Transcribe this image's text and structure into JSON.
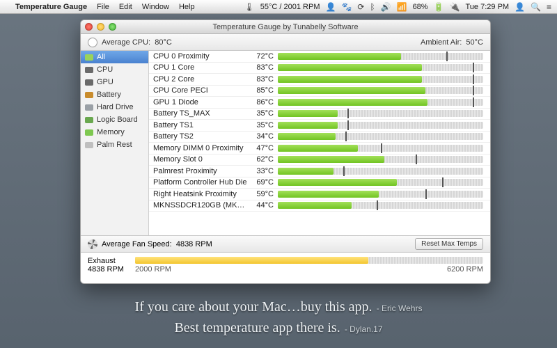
{
  "menubar": {
    "app": "Temperature Gauge",
    "items": [
      "File",
      "Edit",
      "Window",
      "Help"
    ],
    "status_temp": "55°C / 2001 RPM",
    "battery": "68%",
    "clock": "Tue 7:29 PM"
  },
  "window": {
    "title": "Temperature Gauge by Tunabelly Software",
    "avg_cpu_label": "Average CPU:",
    "avg_cpu_value": "80°C",
    "ambient_label": "Ambient Air:",
    "ambient_value": "50°C"
  },
  "sidebar": [
    {
      "label": "All",
      "color": "#9ad35a",
      "selected": true
    },
    {
      "label": "CPU",
      "color": "#6a6a6a"
    },
    {
      "label": "GPU",
      "color": "#6a6a6a"
    },
    {
      "label": "Battery",
      "color": "#c98c2d"
    },
    {
      "label": "Hard Drive",
      "color": "#9aa0a6"
    },
    {
      "label": "Logic Board",
      "color": "#6aa84f"
    },
    {
      "label": "Memory",
      "color": "#7ec850"
    },
    {
      "label": "Palm Rest",
      "color": "#bfbfbf"
    }
  ],
  "sensors": [
    {
      "name": "CPU 0 Proximity",
      "temp": "72°C",
      "fill": 60,
      "mark": 82
    },
    {
      "name": "CPU 1 Core",
      "temp": "83°C",
      "fill": 70,
      "mark": 95
    },
    {
      "name": "CPU 2 Core",
      "temp": "83°C",
      "fill": 70,
      "mark": 95
    },
    {
      "name": "CPU Core PECI",
      "temp": "85°C",
      "fill": 72,
      "mark": 95
    },
    {
      "name": "GPU 1 Diode",
      "temp": "86°C",
      "fill": 73,
      "mark": 95
    },
    {
      "name": "Battery TS_MAX",
      "temp": "35°C",
      "fill": 29,
      "mark": 34
    },
    {
      "name": "Battery TS1",
      "temp": "35°C",
      "fill": 29,
      "mark": 34
    },
    {
      "name": "Battery TS2",
      "temp": "34°C",
      "fill": 28,
      "mark": 33
    },
    {
      "name": "Memory DIMM 0 Proximity",
      "temp": "47°C",
      "fill": 39,
      "mark": 50
    },
    {
      "name": "Memory Slot 0",
      "temp": "62°C",
      "fill": 52,
      "mark": 67
    },
    {
      "name": "Palmrest Proximity",
      "temp": "33°C",
      "fill": 27,
      "mark": 32
    },
    {
      "name": "Platform Controller Hub Die",
      "temp": "69°C",
      "fill": 58,
      "mark": 80
    },
    {
      "name": "Right Heatsink Proximity",
      "temp": "59°C",
      "fill": 49,
      "mark": 72
    },
    {
      "name": "MKNSSDCR120GB (MKN12…",
      "temp": "44°C",
      "fill": 36,
      "mark": 48
    }
  ],
  "fan": {
    "avg_label": "Average Fan Speed:",
    "avg_value": "4838 RPM",
    "reset_label": "Reset Max Temps",
    "name": "Exhaust",
    "current": "4838 RPM",
    "min": "2000 RPM",
    "max": "6200 RPM",
    "fill": 67
  },
  "quotes": [
    {
      "text": "If you care about your Mac…buy this app.",
      "attr": "- Eric Wehrs"
    },
    {
      "text": "Best temperature app there is.",
      "attr": "- Dylan.17"
    }
  ]
}
